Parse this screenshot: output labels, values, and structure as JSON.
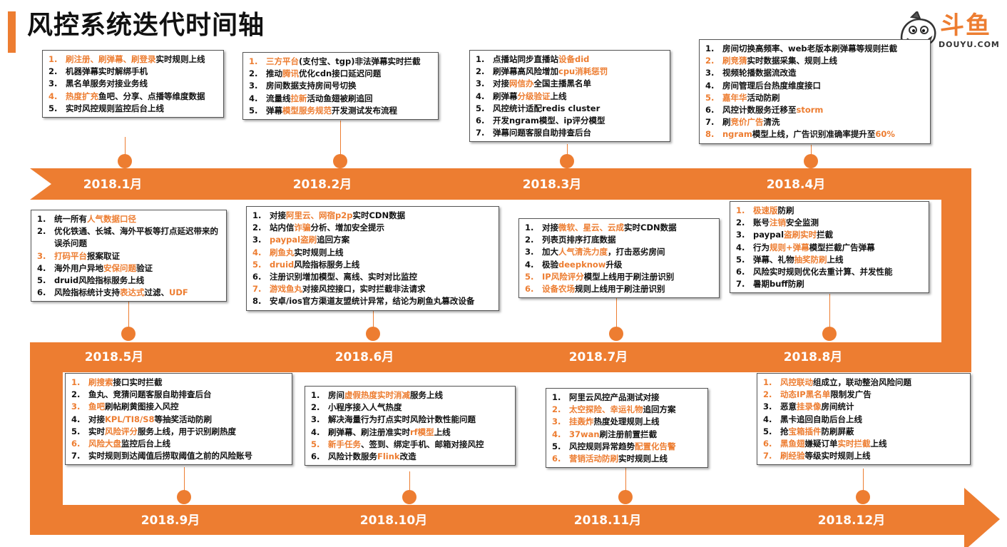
{
  "title": "风控系统迭代时间轴",
  "logo": {
    "text": "斗鱼",
    "sub": "DOUYU.COM"
  },
  "colors": {
    "accent": "#ED7D31"
  },
  "months": [
    "2018.1月",
    "2018.2月",
    "2018.3月",
    "2018.4月",
    "2018.5月",
    "2018.6月",
    "2018.7月",
    "2018.8月",
    "2018.9月",
    "2018.10月",
    "2018.11月",
    "2018.12月"
  ],
  "boxes": [
    {
      "month": "2018.1月",
      "items": [
        {
          "n": "1.",
          "hl": true,
          "parts": [
            {
              "t": "刷注册、刷弹幕、刷登录",
              "o": true
            },
            {
              "t": "实时规则上线"
            }
          ]
        },
        {
          "n": "2.",
          "parts": [
            {
              "t": "机器弹幕实时解绑手机"
            }
          ]
        },
        {
          "n": "3.",
          "parts": [
            {
              "t": "黑名单服务对接业务线"
            }
          ]
        },
        {
          "n": "4.",
          "hl": true,
          "parts": [
            {
              "t": "热度扩充",
              "o": true
            },
            {
              "t": "鱼吧、分享、点播等维度数据"
            }
          ]
        },
        {
          "n": "5.",
          "parts": [
            {
              "t": "实时风控规则监控后台上线"
            }
          ]
        }
      ]
    },
    {
      "month": "2018.2月",
      "items": [
        {
          "n": "1.",
          "hl": true,
          "parts": [
            {
              "t": "三方平台",
              "o": true
            },
            {
              "t": "(支付宝、tgp)非法弹幕实时拦截"
            }
          ]
        },
        {
          "n": "2.",
          "parts": [
            {
              "t": "推动"
            },
            {
              "t": "腾讯",
              "o": true
            },
            {
              "t": "优化cdn接口延迟问题"
            }
          ]
        },
        {
          "n": "3.",
          "parts": [
            {
              "t": "房间数据支持房间号切换"
            }
          ]
        },
        {
          "n": "4.",
          "parts": [
            {
              "t": "流量线"
            },
            {
              "t": "拉新",
              "o": true
            },
            {
              "t": "活动鱼翅被刷追回"
            }
          ]
        },
        {
          "n": "5.",
          "parts": [
            {
              "t": "弹幕"
            },
            {
              "t": "模型服务规范",
              "o": true
            },
            {
              "t": "开发测试发布流程"
            }
          ]
        }
      ]
    },
    {
      "month": "2018.3月",
      "items": [
        {
          "n": "1.",
          "parts": [
            {
              "t": "点播站同步直播站"
            },
            {
              "t": "设备did",
              "o": true
            }
          ]
        },
        {
          "n": "2.",
          "parts": [
            {
              "t": "刷弹幕高风险增加"
            },
            {
              "t": "cpu消耗惩罚",
              "o": true
            }
          ]
        },
        {
          "n": "3.",
          "parts": [
            {
              "t": "对接"
            },
            {
              "t": "网信办",
              "o": true
            },
            {
              "t": "全国主播黑名单"
            }
          ]
        },
        {
          "n": "4.",
          "parts": [
            {
              "t": "刷弹幕"
            },
            {
              "t": "分级验证",
              "o": true
            },
            {
              "t": "上线"
            }
          ]
        },
        {
          "n": "5.",
          "parts": [
            {
              "t": "风控统计适配redis cluster"
            }
          ]
        },
        {
          "n": "6.",
          "parts": [
            {
              "t": "开发ngram模型、ip评分模型"
            }
          ]
        },
        {
          "n": "7.",
          "parts": [
            {
              "t": "弹幕问题客服自助排查后台"
            }
          ]
        }
      ]
    },
    {
      "month": "2018.4月",
      "items": [
        {
          "n": "1.",
          "parts": [
            {
              "t": "房间切换高频率、web老版本刷弹幕等规则拦截"
            }
          ]
        },
        {
          "n": "2.",
          "hl": true,
          "parts": [
            {
              "t": "刷竞猜",
              "o": true
            },
            {
              "t": "实时数据采集、规则上线"
            }
          ]
        },
        {
          "n": "3.",
          "parts": [
            {
              "t": "视频轮播数据流改造"
            }
          ]
        },
        {
          "n": "4.",
          "parts": [
            {
              "t": "房间管理后台热度维度接口"
            }
          ]
        },
        {
          "n": "5.",
          "hl": true,
          "parts": [
            {
              "t": "嘉年华",
              "o": true
            },
            {
              "t": "活动防刷"
            }
          ]
        },
        {
          "n": "6.",
          "parts": [
            {
              "t": "风控计数服务迁移至"
            },
            {
              "t": "storm",
              "o": true
            }
          ]
        },
        {
          "n": "7.",
          "parts": [
            {
              "t": "刷"
            },
            {
              "t": "竞价广告",
              "o": true
            },
            {
              "t": "清洗"
            }
          ]
        },
        {
          "n": "8.",
          "hl": true,
          "parts": [
            {
              "t": "ngram",
              "o": true
            },
            {
              "t": "模型上线，广告识别准确率提升至"
            },
            {
              "t": "60%",
              "o": true
            }
          ]
        }
      ]
    },
    {
      "month": "2018.5月",
      "items": [
        {
          "n": "1.",
          "parts": [
            {
              "t": "统一所有"
            },
            {
              "t": "人气数据口径",
              "o": true
            }
          ]
        },
        {
          "n": "2.",
          "parts": [
            {
              "t": "优化铁通、长城、海外平板等打点延迟带来的误杀问题"
            }
          ]
        },
        {
          "n": "3.",
          "hl": true,
          "parts": [
            {
              "t": "打码平台",
              "o": true
            },
            {
              "t": "报案取证"
            }
          ]
        },
        {
          "n": "4.",
          "parts": [
            {
              "t": "海外用户异地"
            },
            {
              "t": "安保问题",
              "o": true
            },
            {
              "t": "验证"
            }
          ]
        },
        {
          "n": "5.",
          "parts": [
            {
              "t": "druid风险指标服务上线"
            }
          ]
        },
        {
          "n": "6.",
          "parts": [
            {
              "t": "风险指标统计支持"
            },
            {
              "t": "表达式",
              "o": true
            },
            {
              "t": "过滤、"
            },
            {
              "t": "UDF",
              "o": true
            }
          ]
        }
      ]
    },
    {
      "month": "2018.6月",
      "items": [
        {
          "n": "1.",
          "parts": [
            {
              "t": "对接"
            },
            {
              "t": "阿里云、网宿p2p",
              "o": true
            },
            {
              "t": "实时CDN数据"
            }
          ]
        },
        {
          "n": "2.",
          "parts": [
            {
              "t": "站内信"
            },
            {
              "t": "诈骗",
              "o": true
            },
            {
              "t": "分析、增加安全提示"
            }
          ]
        },
        {
          "n": "3.",
          "parts": [
            {
              "t": "paypal盗刷",
              "o": true
            },
            {
              "t": "追回方案"
            }
          ]
        },
        {
          "n": "4.",
          "hl": true,
          "parts": [
            {
              "t": "刷鱼丸",
              "o": true
            },
            {
              "t": "实时规则上线"
            }
          ]
        },
        {
          "n": "5.",
          "hl": true,
          "parts": [
            {
              "t": "druid",
              "o": true
            },
            {
              "t": "风险指标服务上线"
            }
          ]
        },
        {
          "n": "6.",
          "parts": [
            {
              "t": "注册识别增加模型、离线、实时对比监控"
            }
          ]
        },
        {
          "n": "7.",
          "hl": true,
          "parts": [
            {
              "t": "游戏鱼丸",
              "o": true
            },
            {
              "t": "对接风控接口，实时拦截非法请求"
            }
          ]
        },
        {
          "n": "8.",
          "parts": [
            {
              "t": "安卓/ios官方渠道友盟统计异常，结论为刷鱼丸篡改设备"
            }
          ]
        }
      ]
    },
    {
      "month": "2018.7月",
      "items": [
        {
          "n": "1.",
          "parts": [
            {
              "t": "对接"
            },
            {
              "t": "微软、星云、云成",
              "o": true
            },
            {
              "t": "实时CDN数据"
            }
          ]
        },
        {
          "n": "2.",
          "parts": [
            {
              "t": "列表页排序打底数据"
            }
          ]
        },
        {
          "n": "3.",
          "parts": [
            {
              "t": "加大"
            },
            {
              "t": "人气清洗力度",
              "o": true
            },
            {
              "t": "，打击恶劣房间"
            }
          ]
        },
        {
          "n": "4.",
          "parts": [
            {
              "t": "极验"
            },
            {
              "t": "deepknow",
              "o": true
            },
            {
              "t": "升级"
            }
          ]
        },
        {
          "n": "5.",
          "hl": true,
          "parts": [
            {
              "t": "IP风险评分",
              "o": true
            },
            {
              "t": "模型上线用于刷注册识别"
            }
          ]
        },
        {
          "n": "6.",
          "hl": true,
          "parts": [
            {
              "t": "设备农场",
              "o": true
            },
            {
              "t": "规则上线用于刷注册识别"
            }
          ]
        }
      ]
    },
    {
      "month": "2018.8月",
      "items": [
        {
          "n": "1.",
          "hl": true,
          "parts": [
            {
              "t": "极速版",
              "o": true
            },
            {
              "t": "防刷"
            }
          ]
        },
        {
          "n": "2.",
          "parts": [
            {
              "t": "账号"
            },
            {
              "t": "注销",
              "o": true
            },
            {
              "t": "安全监测"
            }
          ]
        },
        {
          "n": "3.",
          "parts": [
            {
              "t": "paypal"
            },
            {
              "t": "盗刷实时",
              "o": true
            },
            {
              "t": "拦截"
            }
          ]
        },
        {
          "n": "4.",
          "parts": [
            {
              "t": "行为"
            },
            {
              "t": "规则+弹幕",
              "o": true
            },
            {
              "t": "模型拦截广告弹幕"
            }
          ]
        },
        {
          "n": "5.",
          "parts": [
            {
              "t": "弹幕、礼物"
            },
            {
              "t": "抽奖防刷",
              "o": true
            },
            {
              "t": "上线"
            }
          ]
        },
        {
          "n": "6.",
          "parts": [
            {
              "t": "风险实时规则优化去重计算、并发性能"
            }
          ]
        },
        {
          "n": "7.",
          "parts": [
            {
              "t": "暑期buff防刷"
            }
          ]
        }
      ]
    },
    {
      "month": "2018.9月",
      "items": [
        {
          "n": "1.",
          "hl": true,
          "parts": [
            {
              "t": "刷搜索",
              "o": true
            },
            {
              "t": "接口实时拦截"
            }
          ]
        },
        {
          "n": "2.",
          "parts": [
            {
              "t": "鱼丸、竞猜问题客服自助排查后台"
            }
          ]
        },
        {
          "n": "3.",
          "hl": true,
          "parts": [
            {
              "t": "鱼吧",
              "o": true
            },
            {
              "t": "刷帖刷黄图接入风控"
            }
          ]
        },
        {
          "n": "4.",
          "parts": [
            {
              "t": "对接"
            },
            {
              "t": "KPL/TI8/S8",
              "o": true
            },
            {
              "t": "等抽奖活动防刷"
            }
          ]
        },
        {
          "n": "5.",
          "parts": [
            {
              "t": "实时"
            },
            {
              "t": "风险评分",
              "o": true
            },
            {
              "t": "服务上线，用于识别刷热度"
            }
          ]
        },
        {
          "n": "6.",
          "hl": true,
          "parts": [
            {
              "t": "风险大盘",
              "o": true
            },
            {
              "t": "监控后台上线"
            }
          ]
        },
        {
          "n": "7.",
          "parts": [
            {
              "t": "实时规则到达阈值后捞取阈值之前的风险账号"
            }
          ]
        }
      ]
    },
    {
      "month": "2018.10月",
      "items": [
        {
          "n": "1.",
          "parts": [
            {
              "t": "房间"
            },
            {
              "t": "虚假热度实时消减",
              "o": true
            },
            {
              "t": "服务上线"
            }
          ]
        },
        {
          "n": "2.",
          "parts": [
            {
              "t": "小程序接入人气热度"
            }
          ]
        },
        {
          "n": "3.",
          "parts": [
            {
              "t": "解决海量行为打点实时风险计数性能问题"
            }
          ]
        },
        {
          "n": "4.",
          "parts": [
            {
              "t": "刷弹幕、刷注册准实时"
            },
            {
              "t": "rf模型",
              "o": true
            },
            {
              "t": "上线"
            }
          ]
        },
        {
          "n": "5.",
          "hl": true,
          "parts": [
            {
              "t": "新手任务",
              "o": true
            },
            {
              "t": "、签到、绑定手机、邮箱对接风控"
            }
          ]
        },
        {
          "n": "6.",
          "parts": [
            {
              "t": "风险计数服务"
            },
            {
              "t": "Flink",
              "o": true
            },
            {
              "t": "改造"
            }
          ]
        }
      ]
    },
    {
      "month": "2018.11月",
      "items": [
        {
          "n": "1.",
          "parts": [
            {
              "t": "阿里云风控产品测试对接"
            }
          ]
        },
        {
          "n": "2.",
          "hl": true,
          "parts": [
            {
              "t": "太空探险、幸运礼物",
              "o": true
            },
            {
              "t": "追回方案"
            }
          ]
        },
        {
          "n": "3.",
          "hl": true,
          "parts": [
            {
              "t": "挂轰炸",
              "o": true
            },
            {
              "t": "热度处理规则上线"
            }
          ]
        },
        {
          "n": "4.",
          "hl": true,
          "parts": [
            {
              "t": "37wan",
              "o": true
            },
            {
              "t": "刷注册前置拦截"
            }
          ]
        },
        {
          "n": "5.",
          "parts": [
            {
              "t": "风控规则异常趋势"
            },
            {
              "t": "配置化告警",
              "o": true
            }
          ]
        },
        {
          "n": "6.",
          "hl": true,
          "parts": [
            {
              "t": "营销活动防刷",
              "o": true
            },
            {
              "t": "实时规则上线"
            }
          ]
        }
      ]
    },
    {
      "month": "2018.12月",
      "items": [
        {
          "n": "1.",
          "hl": true,
          "parts": [
            {
              "t": "风控联动",
              "o": true
            },
            {
              "t": "组成立，联动整治风险问题"
            }
          ]
        },
        {
          "n": "2.",
          "hl": true,
          "parts": [
            {
              "t": "动态IP黑名单",
              "o": true
            },
            {
              "t": "限制发广告"
            }
          ]
        },
        {
          "n": "3.",
          "parts": [
            {
              "t": "恶意"
            },
            {
              "t": "挂录像",
              "o": true
            },
            {
              "t": "房间统计"
            }
          ]
        },
        {
          "n": "4.",
          "parts": [
            {
              "t": "黑卡追回自助后台上线"
            }
          ]
        },
        {
          "n": "5.",
          "parts": [
            {
              "t": "抢"
            },
            {
              "t": "宝箱插件",
              "o": true
            },
            {
              "t": "防刷屏蔽"
            }
          ]
        },
        {
          "n": "6.",
          "hl": true,
          "parts": [
            {
              "t": "黑鱼翅",
              "o": true
            },
            {
              "t": "嫌疑订单"
            },
            {
              "t": "实时拦截",
              "o": true
            },
            {
              "t": "上线"
            }
          ]
        },
        {
          "n": "7.",
          "hl": true,
          "parts": [
            {
              "t": "刷经验",
              "o": true
            },
            {
              "t": "等级实时规则上线"
            }
          ]
        }
      ]
    }
  ]
}
